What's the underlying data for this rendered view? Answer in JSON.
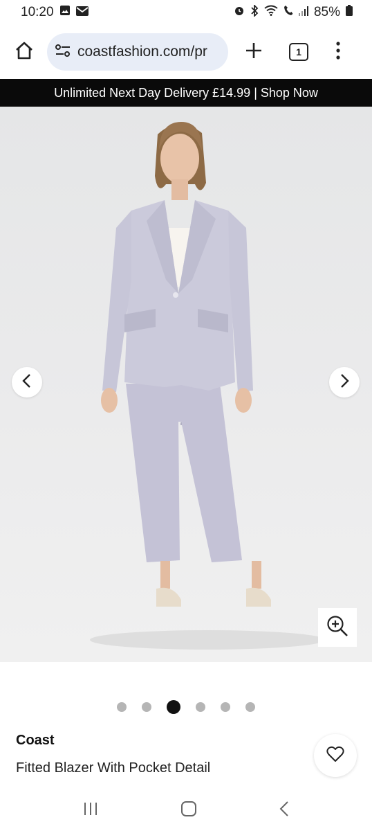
{
  "status": {
    "time": "10:20",
    "battery": "85%",
    "icons": [
      "image-icon",
      "mail-icon",
      "alarm-icon",
      "bluetooth-icon",
      "wifi-icon",
      "call-icon",
      "signal-icon",
      "battery-icon"
    ]
  },
  "browser": {
    "url": "coastfashion.com/pr",
    "tab_count": "1",
    "icons": [
      "home-icon",
      "site-settings-icon",
      "plus-icon",
      "tabs-icon",
      "more-menu-icon"
    ]
  },
  "promo": {
    "text": "Unlimited Next Day Delivery £14.99 | Shop Now"
  },
  "carousel": {
    "total": 6,
    "active_index": 2,
    "icons": [
      "chevron-left-icon",
      "chevron-right-icon",
      "zoom-in-icon"
    ]
  },
  "product": {
    "brand": "Coast",
    "title": "Fitted Blazer With Pocket Detail",
    "suit_color": "#c9c8d8",
    "icons": [
      "heart-icon"
    ]
  },
  "nav": {
    "icons": [
      "recents-icon",
      "home-nav-icon",
      "back-icon"
    ]
  }
}
